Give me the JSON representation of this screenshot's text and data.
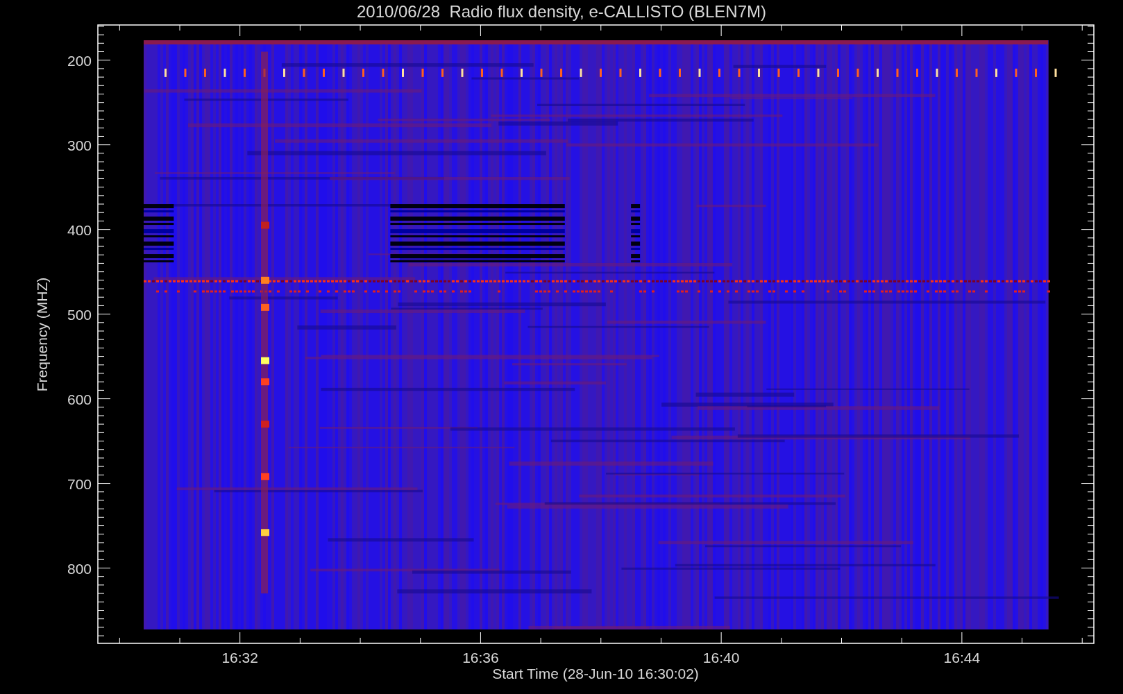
{
  "plot": {
    "title": "2010/06/28  Radio flux density, e-CALLISTO (BLEN7M)",
    "xlabel": "Start Time (28-Jun-10 16:30:02)",
    "ylabel": "Frequency (MHZ)",
    "xticks": [
      "16:32",
      "16:36",
      "16:40",
      "16:44"
    ],
    "yticks": [
      "200",
      "300",
      "400",
      "500",
      "600",
      "700",
      "800"
    ]
  }
}
